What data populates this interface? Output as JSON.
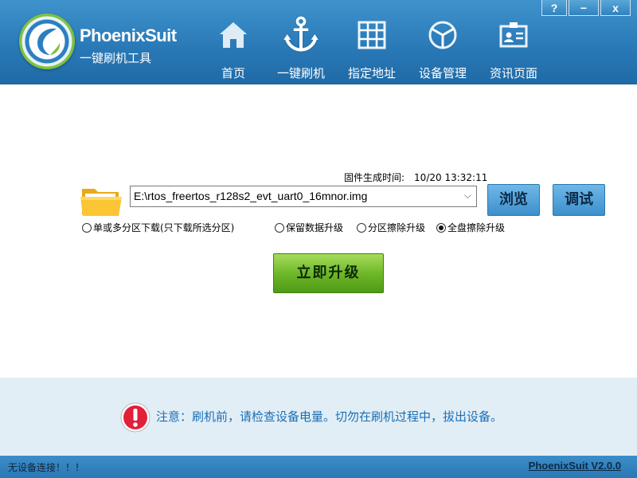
{
  "app": {
    "name": "PhoenixSuit",
    "subtitle": "一键刷机工具"
  },
  "window_buttons": {
    "help": "?",
    "minimize": "−",
    "close": "x"
  },
  "nav": [
    {
      "label": "首页",
      "icon": "home-icon"
    },
    {
      "label": "一键刷机",
      "icon": "anchor-icon",
      "active": true
    },
    {
      "label": "指定地址",
      "icon": "grid-icon"
    },
    {
      "label": "设备管理",
      "icon": "device-cube-icon"
    },
    {
      "label": "资讯页面",
      "icon": "id-card-icon"
    }
  ],
  "firmware": {
    "time_label": "固件生成时间:",
    "time_value": "10/20 13:32:11"
  },
  "image_path": "E:\\rtos_freertos_r128s2_evt_uart0_16mnor.img",
  "buttons": {
    "browse": "浏览",
    "debug": "调试",
    "upgrade": "立即升级"
  },
  "options": {
    "download_mode": "单或多分区下载(只下载所选分区)",
    "keep_data": "保留数据升级",
    "partition_erase": "分区擦除升级",
    "full_erase": "全盘擦除升级",
    "selected": "full_erase"
  },
  "notice": {
    "text": "注意：刷机前，请检查设备电量。切勿在刷机过程中，拔出设备。"
  },
  "status": {
    "left": "无设备连接！！！",
    "version": "PhoenixSuit V2.0.0"
  },
  "colors": {
    "header": "#2a7ab8",
    "notice_bg": "#e2eef6",
    "notice_text": "#1a6fb5",
    "upgrade_green": "#6fb82a"
  }
}
